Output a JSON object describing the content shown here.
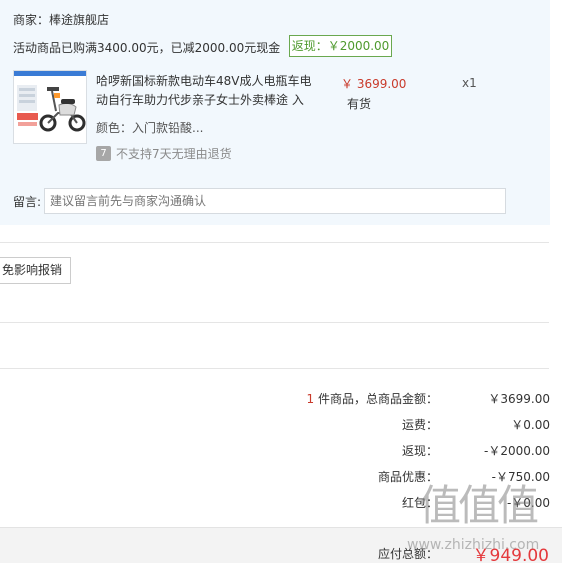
{
  "order": {
    "merchant": "商家：棒途旗舰店",
    "promo": "活动商品已购满3400.00元，已减2000.00元现金",
    "cashback_badge": "返现：￥2000.00",
    "item": {
      "title": "哈啰新国标新款电动车48V成人电瓶车电动自行车助力代步亲子女士外卖棒途 入",
      "variant": "颜色：入门款铅酸...",
      "policy_icon": "7",
      "policy": "不支持7天无理由退货",
      "price": "￥ 3699.00",
      "stock": "有货",
      "qty": "x1"
    },
    "note": {
      "label": "留言:",
      "placeholder": "建议留言前先与商家沟通确认"
    }
  },
  "tag_button": "免影响报销",
  "summary": {
    "count": "1",
    "items_label": "件商品，总商品金额：",
    "items_value": "￥3699.00",
    "shipping_label": "运费：",
    "shipping_value": "￥0.00",
    "cashback_label": "返现：",
    "cashback_value": "-￥2000.00",
    "discount_label": "商品优惠：",
    "discount_value": "-￥750.00",
    "redpacket_label": "红包：",
    "redpacket_value": "-￥0.00"
  },
  "total": {
    "label": "应付总额：",
    "value": "￥949.00"
  },
  "watermark": {
    "logo": "值值值",
    "url": "www.zhizhizhi.com"
  },
  "icons": {
    "thumbnail": "electric-scooter-image",
    "policy": "no-return-policy-icon"
  }
}
